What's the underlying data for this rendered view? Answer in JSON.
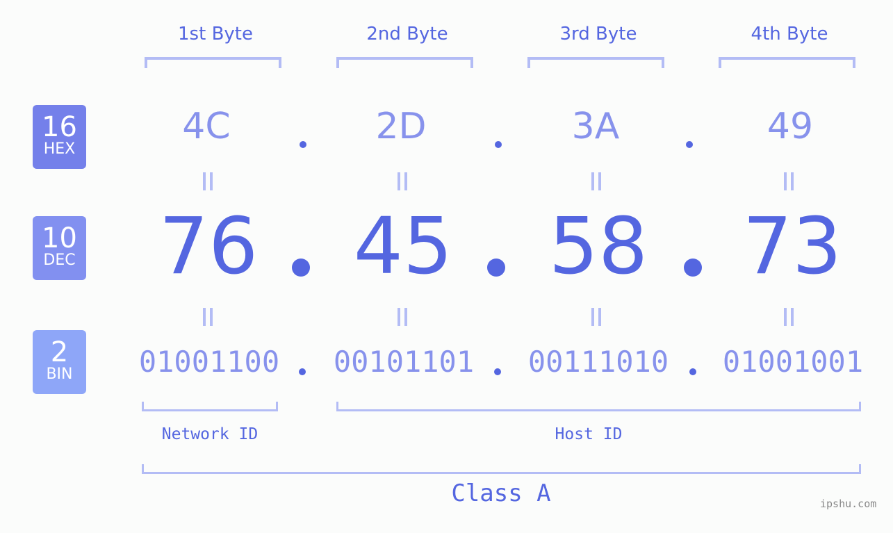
{
  "colors": {
    "accent": "#5466e0",
    "light": "#8792ec",
    "bracket": "#b3bcf5",
    "hex_badge": "#7480ea",
    "dec_badge": "#8290f0",
    "bin_badge": "#8ea6f8"
  },
  "badges": [
    {
      "num": "16",
      "label": "HEX"
    },
    {
      "num": "10",
      "label": "DEC"
    },
    {
      "num": "2",
      "label": "BIN"
    }
  ],
  "byte_headers": [
    "1st Byte",
    "2nd Byte",
    "3rd Byte",
    "4th Byte"
  ],
  "hex": [
    "4C",
    "2D",
    "3A",
    "49"
  ],
  "dec": [
    "76",
    "45",
    "58",
    "73"
  ],
  "bin": [
    "01001100",
    "00101101",
    "00111010",
    "01001001"
  ],
  "network_label": "Network ID",
  "host_label": "Host ID",
  "class_label": "Class A",
  "watermark": "ipshu.com"
}
